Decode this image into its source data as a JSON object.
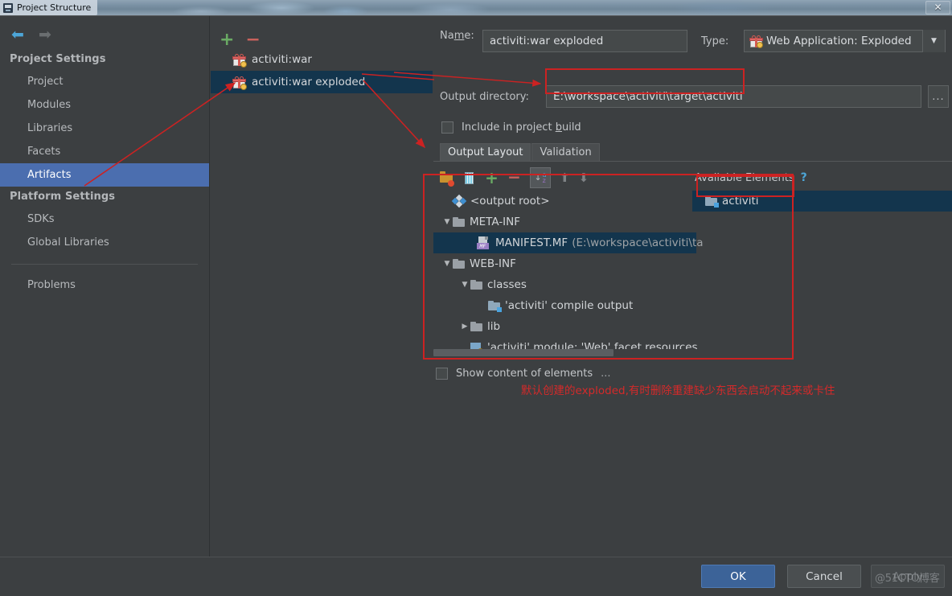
{
  "window": {
    "title": "Project Structure",
    "close_label": "✕"
  },
  "nav": {
    "back_icon": "⬅",
    "forward_icon": "➡"
  },
  "sidebar": {
    "groups": [
      {
        "label": "Project Settings",
        "items": [
          {
            "label": "Project",
            "selected": false
          },
          {
            "label": "Modules",
            "selected": false
          },
          {
            "label": "Libraries",
            "selected": false
          },
          {
            "label": "Facets",
            "selected": false
          },
          {
            "label": "Artifacts",
            "selected": true
          }
        ]
      },
      {
        "label": "Platform Settings",
        "items": [
          {
            "label": "SDKs",
            "selected": false
          },
          {
            "label": "Global Libraries",
            "selected": false
          }
        ]
      }
    ],
    "problems_label": "Problems"
  },
  "artifacts_panel": {
    "add_label": "+",
    "remove_label": "−",
    "items": [
      {
        "label": "activiti:war",
        "selected": false
      },
      {
        "label": "activiti:war exploded",
        "selected": true
      }
    ]
  },
  "details": {
    "name_label": "Name:",
    "name_value": "activiti:war exploded",
    "type_label": "Type:",
    "type_value": "Web Application: Exploded",
    "type_arrow": "▼",
    "output_dir_label": "Output directory:",
    "output_dir_value": "E:\\workspace\\activiti\\target\\activiti",
    "browse_label": "...",
    "include_in_build_label_pre": "Include in project ",
    "include_in_build_label_mnemonic": "b",
    "include_in_build_label_post": "uild",
    "include_in_build_checked": false,
    "tabs": [
      {
        "label": "Output Layout",
        "active": true
      },
      {
        "label": "Validation",
        "active": false
      }
    ],
    "toolbar": {
      "create_dir_icon": "folder-add-icon",
      "create_archive_icon": "archive-icon",
      "add_icon": "+",
      "remove_icon": "−",
      "sort_icon": "sort-az-icon",
      "sort_a": "a",
      "sort_z": "z",
      "move_up_icon": "▲",
      "move_down_icon": "▼"
    },
    "available_elements_label": "Available Elements",
    "help_label": "?",
    "show_content_label": "Show content of elements",
    "show_content_suffix": "...",
    "show_content_checked": false
  },
  "output_tree": [
    {
      "indent": 0,
      "twisty": "",
      "icon": "output-root-icon",
      "label": "<output root>",
      "path": "",
      "selected": false
    },
    {
      "indent": 0,
      "twisty": "▼",
      "icon": "folder-icon",
      "label": "META-INF",
      "path": "",
      "selected": false
    },
    {
      "indent": 1,
      "twisty": "",
      "icon": "manifest-icon",
      "label": "MANIFEST.MF",
      "path": "(E:\\workspace\\activiti\\ta",
      "selected": true
    },
    {
      "indent": 0,
      "twisty": "▼",
      "icon": "folder-icon",
      "label": "WEB-INF",
      "path": "",
      "selected": false
    },
    {
      "indent": 1,
      "twisty": "▼",
      "icon": "folder-icon",
      "label": "classes",
      "path": "",
      "selected": false
    },
    {
      "indent": 2,
      "twisty": "",
      "icon": "module-output-icon",
      "label": "'activiti' compile output",
      "path": "",
      "selected": false
    },
    {
      "indent": 1,
      "twisty": "▶",
      "icon": "folder-icon",
      "label": "lib",
      "path": "",
      "selected": false
    },
    {
      "indent": 1,
      "twisty": "",
      "icon": "facet-icon",
      "label": "'activiti' module: 'Web' facet resources",
      "path": "",
      "selected": false
    }
  ],
  "available_elements": [
    {
      "label": "activiti",
      "icon": "module-output-icon",
      "selected": true
    }
  ],
  "annotation": {
    "note_text": "默认创建的exploded,有时删除重建缺少东西会启动不起来或卡住",
    "color": "#d42a2a"
  },
  "footer": {
    "ok_label": "OK",
    "cancel_label": "Cancel",
    "apply_label": "Apply",
    "apply_disabled": true,
    "watermark": "@51CTO博客"
  },
  "colors": {
    "accent_selection": "#4b6eaf",
    "tree_selection": "#13354d",
    "annotation_red": "#cc2222",
    "primary_button": "#3c6398",
    "background": "#3c3f41"
  }
}
